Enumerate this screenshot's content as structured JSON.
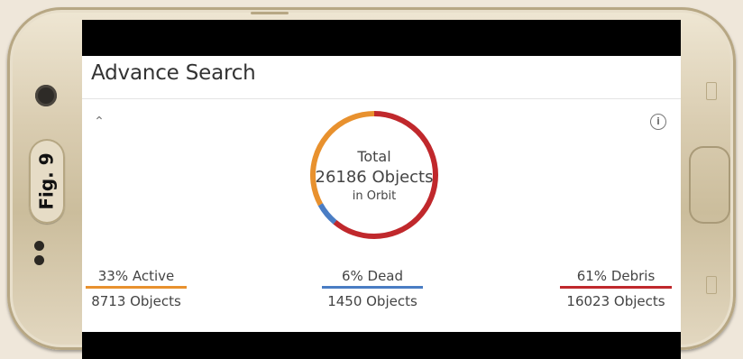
{
  "figure_label": "Fig. 9",
  "app": {
    "title": "Advance Search",
    "collapse_icon": "chevron-up",
    "info_icon": "info"
  },
  "summary": {
    "total_label": "Total",
    "total_count": "26186 Objects",
    "orbit_label": "in Orbit"
  },
  "stats": [
    {
      "key": "active",
      "label": "33% Active",
      "count": "8713 Objects",
      "percent": 33,
      "color": "#e8912e"
    },
    {
      "key": "dead",
      "label": "6% Dead",
      "count": "1450 Objects",
      "percent": 6,
      "color": "#4a7dc4"
    },
    {
      "key": "debris",
      "label": "61% Debris",
      "count": "16023 Objects",
      "percent": 61,
      "color": "#c0282c"
    }
  ],
  "chart_data": {
    "type": "pie",
    "categories": [
      "Active",
      "Dead",
      "Debris"
    ],
    "values": [
      33,
      6,
      61
    ],
    "colors": [
      "#e8912e",
      "#4a7dc4",
      "#c0282c"
    ]
  }
}
